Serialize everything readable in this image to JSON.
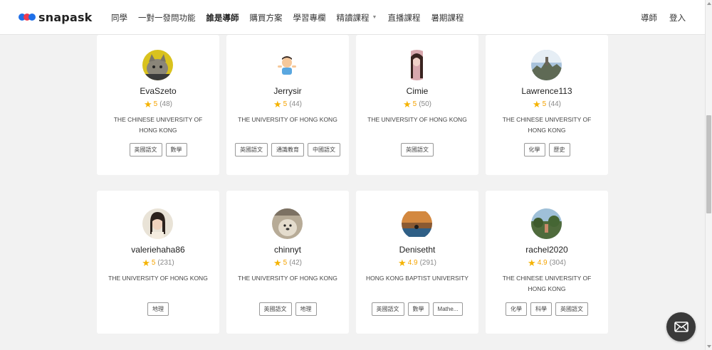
{
  "header": {
    "logo_text": "snapask",
    "nav": [
      {
        "label": "同學",
        "active": false
      },
      {
        "label": "一對一發問功能",
        "active": false
      },
      {
        "label": "誰是導師",
        "active": true
      },
      {
        "label": "購買方案",
        "active": false
      },
      {
        "label": "學習專欄",
        "active": false
      },
      {
        "label": "精讀課程",
        "active": false,
        "dropdown": true
      },
      {
        "label": "直播課程",
        "active": false
      },
      {
        "label": "暑期課程",
        "active": false
      }
    ],
    "right": [
      {
        "label": "導師"
      },
      {
        "label": "登入"
      }
    ]
  },
  "tutors": [
    {
      "name": "EvaSzeto",
      "rating": "5",
      "count": "(48)",
      "school": "THE CHINESE UNIVERSITY OF HONG KONG",
      "tags": [
        "英國語文",
        "數學"
      ],
      "avatar": "cat-photo"
    },
    {
      "name": "Jerrysir",
      "rating": "5",
      "count": "(44)",
      "school": "THE UNIVERSITY OF HONG KONG",
      "tags": [
        "英國語文",
        "通識教育",
        "中國語文"
      ],
      "avatar": "shrug-emoji"
    },
    {
      "name": "Cimie",
      "rating": "5",
      "count": "(50)",
      "school": "THE UNIVERSITY OF HONG KONG",
      "tags": [
        "英國語文"
      ],
      "avatar": "portrait-photo"
    },
    {
      "name": "Lawrence113",
      "rating": "5",
      "count": "(44)",
      "school": "THE CHINESE UNIVERSITY OF HONG KONG",
      "tags": [
        "化學",
        "歷史"
      ],
      "avatar": "landscape-photo"
    },
    {
      "name": "valeriehaha86",
      "rating": "5",
      "count": "(231)",
      "school": "THE UNIVERSITY OF HONG KONG",
      "tags": [
        "地理"
      ],
      "avatar": "girl-photo"
    },
    {
      "name": "chinnyt",
      "rating": "5",
      "count": "(42)",
      "school": "THE UNIVERSITY OF HONG KONG",
      "tags": [
        "英國語文",
        "地理"
      ],
      "avatar": "dog-photo"
    },
    {
      "name": "Denisetht",
      "rating": "4.9",
      "count": "(291)",
      "school": "HONG KONG BAPTIST UNIVERSITY",
      "tags": [
        "英國語文",
        "數學",
        "Mathe..."
      ],
      "avatar": "sunset-photo"
    },
    {
      "name": "rachel2020",
      "rating": "4.9",
      "count": "(304)",
      "school": "THE CHINESE UNIVERSITY OF HONG KONG",
      "tags": [
        "化學",
        "科學",
        "英國語文"
      ],
      "avatar": "garden-photo"
    }
  ],
  "colors": {
    "brand_blue": "#1f6fe8",
    "brand_red": "#ef3b4f",
    "star": "#f5b301",
    "background": "#f2f2f2"
  },
  "icons": {
    "chat": "envelope-icon"
  }
}
